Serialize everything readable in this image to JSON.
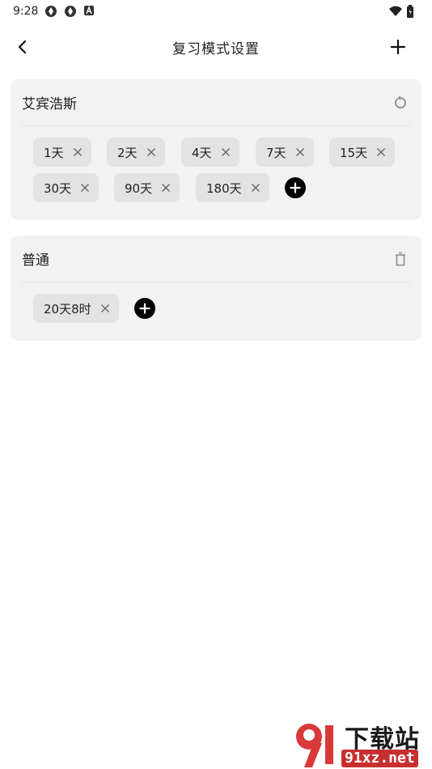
{
  "status_bar": {
    "time": "9:28"
  },
  "header": {
    "title": "复习模式设置"
  },
  "cards": [
    {
      "title": "艾宾浩斯",
      "action_icon": "reset-icon",
      "chips": [
        "1天",
        "2天",
        "4天",
        "7天",
        "15天",
        "30天",
        "90天",
        "180天"
      ]
    },
    {
      "title": "普通",
      "action_icon": "trash-icon",
      "chips": [
        "20天8时"
      ]
    }
  ],
  "watermark": {
    "text_top": "下载站",
    "text_bottom": "91xz.net"
  },
  "colors": {
    "card_bg": "#f2f2f2",
    "chip_bg": "#e3e3e3",
    "add_button": "#000000",
    "watermark_red": "#c83030"
  }
}
